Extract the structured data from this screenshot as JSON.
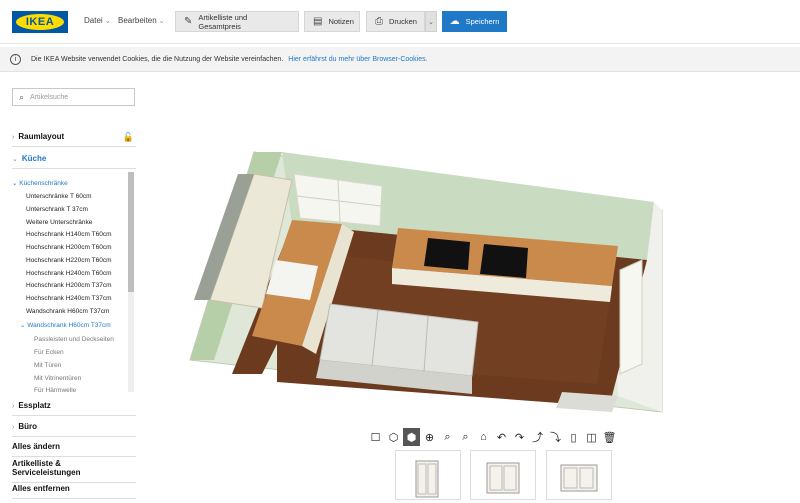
{
  "header": {
    "logo_text": "IKEA",
    "menu_datei": "Datei",
    "menu_bearbeiten": "Bearbeiten",
    "btn_artikelliste": "Artikelliste und Gesamtpreis",
    "btn_notizen": "Notizen",
    "btn_drucken": "Drucken",
    "btn_speichern": "Speichern"
  },
  "cookie": {
    "text": "Die IKEA Website verwendet Cookies, die die Nutzung der Website vereinfachen.",
    "link": "Hier erfährst du mehr über Browser-Cookies."
  },
  "sidebar": {
    "search_placeholder": "Artikelsuche",
    "raumlayout": "Raumlayout",
    "kueche": "Küche",
    "kuechenschraenke": "Küchenschränke",
    "items": [
      "Unterschränke T 60cm",
      "Unterschrank T 37cm",
      "Weitere Unterschränke",
      "Hochschrank H140cm T60cm",
      "Hochschrank H200cm T60cm",
      "Hochschrank H220cm T60cm",
      "Hochschrank H240cm T60cm",
      "Hochschrank H200cm T37cm",
      "Hochschrank H240cm T37cm",
      "Wandschrank H60cm T37cm"
    ],
    "wandschrank_open": "Wandschrank H60cm T37cm",
    "subitems": [
      "Passleisten und Deckseiten",
      "Für Ecken",
      "Mit Türen",
      "Mit Vitrinentüren",
      "Für Härmwelle"
    ],
    "essplatz": "Essplatz",
    "buero": "Büro",
    "alles_aendern": "Alles ändern",
    "artikelliste": "Artikelliste &",
    "serviceleistungen": "Serviceleistungen",
    "alles_entfernen": "Alles entfernen"
  },
  "colors": {
    "accent": "#1f79c6",
    "ikea_blue": "#0058a3",
    "ikea_yellow": "#ffdb00",
    "wall_green": "#c9dcc1",
    "floor_wood": "#6b3a1f",
    "countertop": "#c98a4b"
  },
  "icons": [
    "checkbox-icon",
    "cube-outline-icon",
    "cube-solid-icon",
    "zoom-fit-icon",
    "zoom-in-icon",
    "zoom-out-icon",
    "home-icon",
    "rotate-left-icon",
    "rotate-right-icon",
    "rotate-up-icon",
    "rotate-down-icon",
    "door-icon",
    "camera-icon",
    "trash-icon"
  ]
}
